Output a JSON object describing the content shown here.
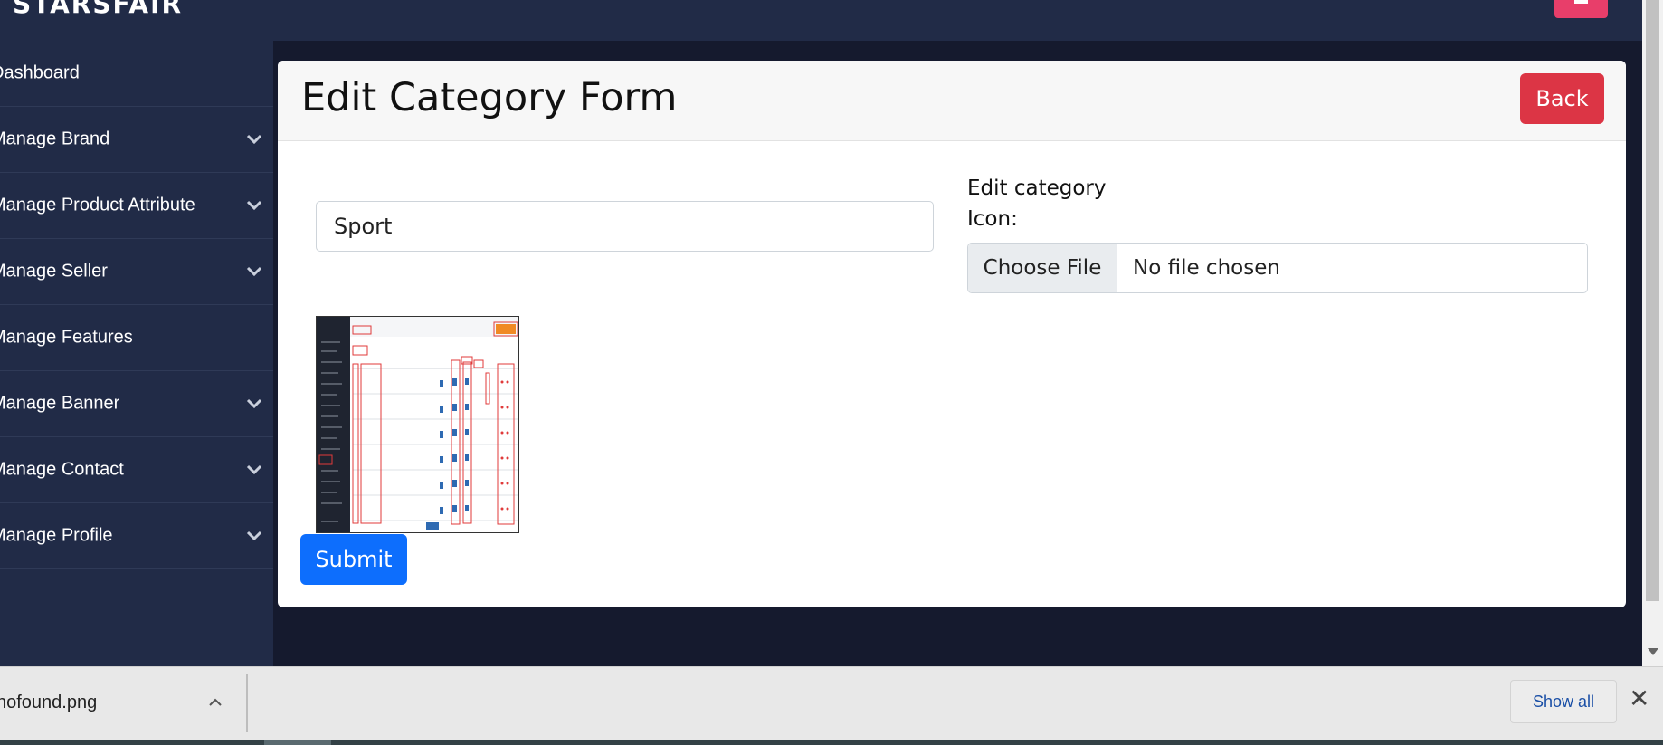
{
  "app": {
    "brand": "STARSFAIR"
  },
  "sidebar": {
    "items": [
      {
        "label": "Dashboard",
        "has_dropdown": false
      },
      {
        "label": "Manage Brand",
        "has_dropdown": true
      },
      {
        "label": "Manage Product Attribute",
        "has_dropdown": true
      },
      {
        "label": "Manage Seller",
        "has_dropdown": true
      },
      {
        "label": "Manage Features",
        "has_dropdown": false
      },
      {
        "label": "Manage Banner",
        "has_dropdown": true
      },
      {
        "label": "Manage Contact",
        "has_dropdown": true
      },
      {
        "label": "Manage Profile",
        "has_dropdown": true
      }
    ]
  },
  "form": {
    "title": "Edit Category Form",
    "back_label": "Back",
    "name_value": "Sport",
    "icon_label": "Edit category Icon:",
    "choose_file_label": "Choose File",
    "file_status": "No file chosen",
    "submit_label": "Submit"
  },
  "downloads": {
    "file_name": "nofound.png",
    "show_all_label": "Show all",
    "close_glyph": "✕"
  },
  "colors": {
    "topbar": "#212b47",
    "sidebar": "#212b47",
    "content_bg": "#151a2e",
    "back_button": "#dc3545",
    "submit_button": "#0d6efd",
    "top_right_button": "#e83e6a"
  }
}
